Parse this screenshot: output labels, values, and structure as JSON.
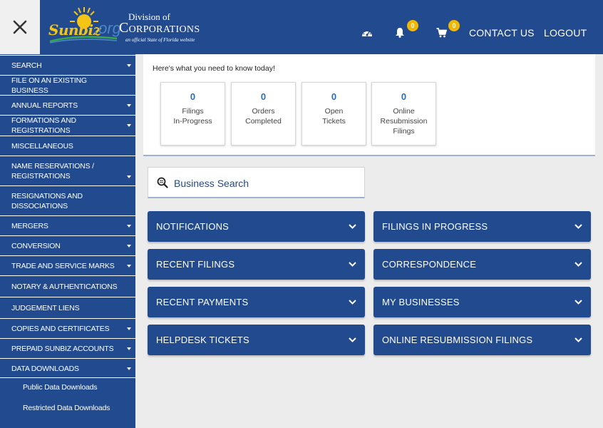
{
  "header": {
    "logo": {
      "sunbiz": "Sunbiz",
      "org": ".org",
      "division": "Division of",
      "corporations": "Corporations",
      "tagline": "an official State of Florida website"
    },
    "notifications_count": "0",
    "cart_count": "0",
    "contact_label": "CONTACT US",
    "logout_label": "LOGOUT",
    "icons": {
      "close": "close-icon",
      "dashboard": "dashboard-gauge-icon",
      "bell": "bell-icon",
      "cart": "cart-icon"
    }
  },
  "sidebar": {
    "items": [
      {
        "label": "SEARCH",
        "expandable": true
      },
      {
        "label": "FILE ON AN EXISTING BUSINESS",
        "expandable": false
      },
      {
        "label": "ANNUAL REPORTS",
        "expandable": true
      },
      {
        "label": "FORMATIONS AND REGISTRATIONS",
        "expandable": true
      },
      {
        "label": "MISCELLANEOUS",
        "expandable": false
      },
      {
        "label": "NAME RESERVATIONS / REGISTRATIONS",
        "expandable": true
      },
      {
        "label": "RESIGNATIONS AND DISSOCIATIONS",
        "expandable": false
      },
      {
        "label": "MERGERS",
        "expandable": true
      },
      {
        "label": "CONVERSION",
        "expandable": true
      },
      {
        "label": "TRADE AND SERVICE MARKS",
        "expandable": true
      },
      {
        "label": "NOTARY & AUTHENTICATIONS",
        "expandable": false
      },
      {
        "label": "JUDGEMENT LIENS",
        "expandable": false
      },
      {
        "label": "COPIES AND CERTIFICATES",
        "expandable": true
      },
      {
        "label": "PREPAID SUNBIZ ACCOUNTS",
        "expandable": true
      },
      {
        "label": "DATA DOWNLOADS",
        "expandable": true
      }
    ],
    "sub_items": [
      {
        "label": "Public Data Downloads"
      },
      {
        "label": "Restricted Data Downloads"
      }
    ]
  },
  "summary": {
    "intro": "Here's what you need to know today!",
    "stats": [
      {
        "value": "0",
        "label": "Filings\nIn-Progress"
      },
      {
        "value": "0",
        "label": "Orders\nCompleted"
      },
      {
        "value": "0",
        "label": "Open\nTickets"
      },
      {
        "value": "0",
        "label": "Online\nResubmission\nFilings"
      }
    ]
  },
  "search": {
    "label": "Business Search",
    "icon": "search-icon"
  },
  "accordions": {
    "left": [
      {
        "label": "NOTIFICATIONS"
      },
      {
        "label": "RECENT FILINGS"
      },
      {
        "label": "RECENT PAYMENTS"
      },
      {
        "label": "HELPDESK TICKETS"
      }
    ],
    "right": [
      {
        "label": "FILINGS IN PROGRESS"
      },
      {
        "label": "CORRESPONDENCE"
      },
      {
        "label": "MY BUSINESSES"
      },
      {
        "label": "ONLINE RESUBMISSION FILINGS"
      }
    ]
  },
  "colors": {
    "primary": "#224a8e",
    "badge": "#f2b705",
    "stat_number": "#2e6db4",
    "background": "#ececec"
  }
}
